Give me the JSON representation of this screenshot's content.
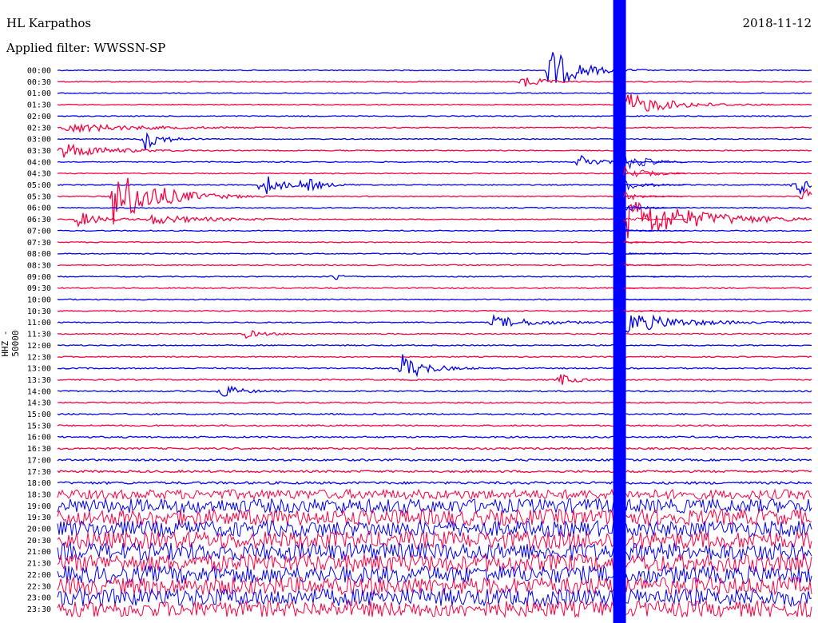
{
  "header": {
    "station": "HL Karpathos",
    "date": "2018-11-12",
    "filter": "Applied filter: WWSSN-SP"
  },
  "chart_data": {
    "type": "line",
    "title": "HL Karpathos",
    "ylabel": "HHZ - 50000",
    "colors": [
      "#0000ff",
      "#ff0040"
    ],
    "times": [
      "00:00",
      "00:30",
      "01:00",
      "01:30",
      "02:00",
      "02:30",
      "03:00",
      "03:30",
      "04:00",
      "04:30",
      "05:00",
      "05:30",
      "06:00",
      "06:30",
      "07:00",
      "07:30",
      "08:00",
      "08:30",
      "09:00",
      "09:30",
      "10:00",
      "10:30",
      "11:00",
      "11:30",
      "12:00",
      "12:30",
      "13:00",
      "13:30",
      "14:00",
      "14:30",
      "15:00",
      "15:30",
      "16:00",
      "16:30",
      "17:00",
      "17:30",
      "18:00",
      "18:30",
      "19:00",
      "19:30",
      "20:00",
      "20:30",
      "21:00",
      "21:30",
      "22:00",
      "22:30",
      "23:00",
      "23:30"
    ],
    "trace_window_minutes": 30,
    "noise_levels": [
      0.6,
      0.6,
      0.6,
      0.6,
      0.6,
      0.6,
      0.6,
      0.6,
      0.6,
      0.6,
      0.6,
      0.6,
      0.6,
      0.6,
      0.6,
      0.6,
      0.6,
      0.6,
      0.6,
      0.7,
      0.7,
      0.7,
      0.7,
      0.7,
      0.7,
      0.7,
      0.8,
      0.8,
      0.8,
      0.8,
      0.9,
      0.9,
      1.0,
      1.1,
      1.2,
      1.3,
      1.5,
      6,
      9,
      10,
      10,
      11,
      11,
      11,
      11,
      11,
      11,
      10
    ],
    "events": [
      {
        "trace": 0,
        "minute": 19.5,
        "amp": 30,
        "duration": 1.0
      },
      {
        "trace": 1,
        "minute": 18.5,
        "amp": 10,
        "duration": 0.6
      },
      {
        "trace": 3,
        "minute": 22.5,
        "amp": 16,
        "duration": 1.5
      },
      {
        "trace": 5,
        "minute": 0.3,
        "amp": 6,
        "duration": 2.5
      },
      {
        "trace": 6,
        "minute": 3.4,
        "amp": 16,
        "duration": 0.6
      },
      {
        "trace": 7,
        "minute": 0.2,
        "amp": 10,
        "duration": 1.5
      },
      {
        "trace": 8,
        "minute": 20.8,
        "amp": 10,
        "duration": 0.6
      },
      {
        "trace": 10,
        "minute": 8.1,
        "amp": 18,
        "duration": 0.6
      },
      {
        "trace": 10,
        "minute": 9.8,
        "amp": 10,
        "duration": 0.6
      },
      {
        "trace": 10,
        "minute": 29.3,
        "amp": 18,
        "duration": 0.6
      },
      {
        "trace": 11,
        "minute": 2.2,
        "amp": 40,
        "duration": 1.5
      },
      {
        "trace": 11,
        "minute": 29.6,
        "amp": 10,
        "duration": 1.2
      },
      {
        "trace": 13,
        "minute": 0.8,
        "amp": 10,
        "duration": 0.8
      },
      {
        "trace": 13,
        "minute": 3.7,
        "amp": 6,
        "duration": 2.0
      },
      {
        "trace": 13,
        "minute": 22.5,
        "amp": 30,
        "duration": 2.5
      },
      {
        "trace": 18,
        "minute": 11.0,
        "amp": 6,
        "duration": 0.3
      },
      {
        "trace": 22,
        "minute": 17.3,
        "amp": 8,
        "duration": 1.5
      },
      {
        "trace": 22,
        "minute": 22.3,
        "amp": 16,
        "duration": 1.8
      },
      {
        "trace": 23,
        "minute": 7.5,
        "amp": 5,
        "duration": 0.6
      },
      {
        "trace": 26,
        "minute": 13.7,
        "amp": 18,
        "duration": 0.8
      },
      {
        "trace": 27,
        "minute": 20.0,
        "amp": 8,
        "duration": 0.5
      },
      {
        "trace": 28,
        "minute": 6.5,
        "amp": 10,
        "duration": 0.6
      }
    ],
    "event_column_minute": 22.2
  }
}
